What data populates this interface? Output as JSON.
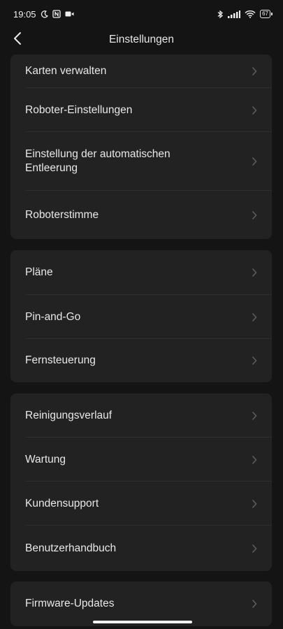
{
  "status_bar": {
    "time": "19:05",
    "battery": "67",
    "icons_left": [
      "moon-icon",
      "nfc-icon",
      "video-icon"
    ],
    "icons_right": [
      "bluetooth-icon",
      "signal-icon",
      "wifi-icon",
      "battery-icon"
    ]
  },
  "header": {
    "title": "Einstellungen",
    "back_icon": "chevron-left-icon"
  },
  "groups": [
    {
      "items": [
        {
          "label": "Karten verwalten"
        },
        {
          "label": "Roboter-Einstellungen"
        },
        {
          "label": "Einstellung der automatischen Entleerung"
        },
        {
          "label": "Roboterstimme"
        }
      ]
    },
    {
      "items": [
        {
          "label": "Pläne"
        },
        {
          "label": "Pin-and-Go"
        },
        {
          "label": "Fernsteuerung"
        }
      ]
    },
    {
      "items": [
        {
          "label": "Reinigungsverlauf"
        },
        {
          "label": "Wartung"
        },
        {
          "label": "Kundensupport"
        },
        {
          "label": "Benutzerhandbuch"
        }
      ]
    },
    {
      "items": [
        {
          "label": "Firmware-Updates"
        }
      ]
    }
  ],
  "colors": {
    "background": "#141414",
    "card": "#222222",
    "text": "#e8e8e8",
    "chevron": "#5e5e5e",
    "divider": "#2e2e2e"
  }
}
